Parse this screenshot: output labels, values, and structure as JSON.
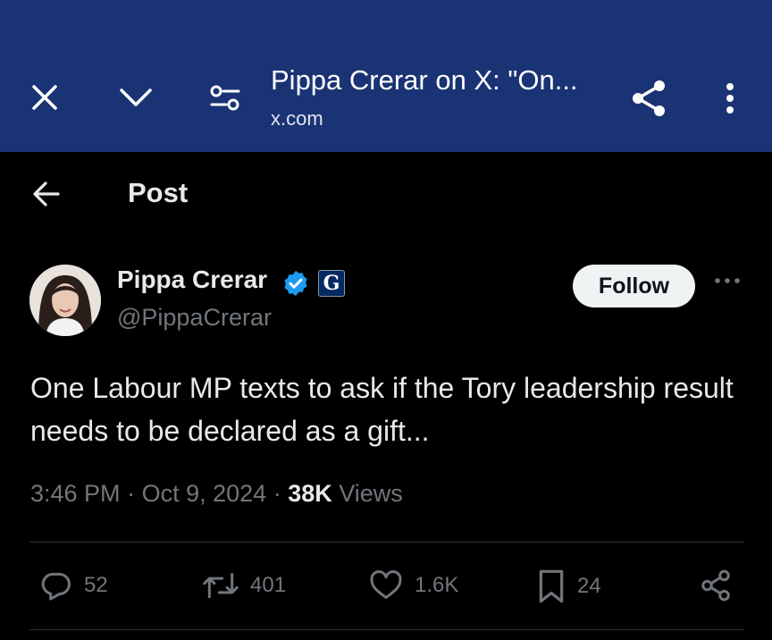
{
  "browser": {
    "title": "Pippa Crerar on X: \"On...",
    "url": "x.com"
  },
  "page": {
    "title": "Post"
  },
  "post": {
    "author_name": "Pippa Crerar",
    "handle": "@PippaCrerar",
    "affiliate_badge": "G",
    "follow_label": "Follow",
    "text": "One Labour MP texts to ask if the Tory leadership result needs to be declared as a gift...",
    "time": "3:46 PM",
    "date": "Oct 9, 2024",
    "views_count": "38K",
    "views_label": "Views",
    "separator": "·"
  },
  "actions": {
    "replies": "52",
    "reposts": "401",
    "likes": "1.6K",
    "bookmarks": "24"
  },
  "colors": {
    "browser_bar": "#1a3374",
    "background": "#000000",
    "verified": "#1d9bf0",
    "muted": "#71767b"
  }
}
